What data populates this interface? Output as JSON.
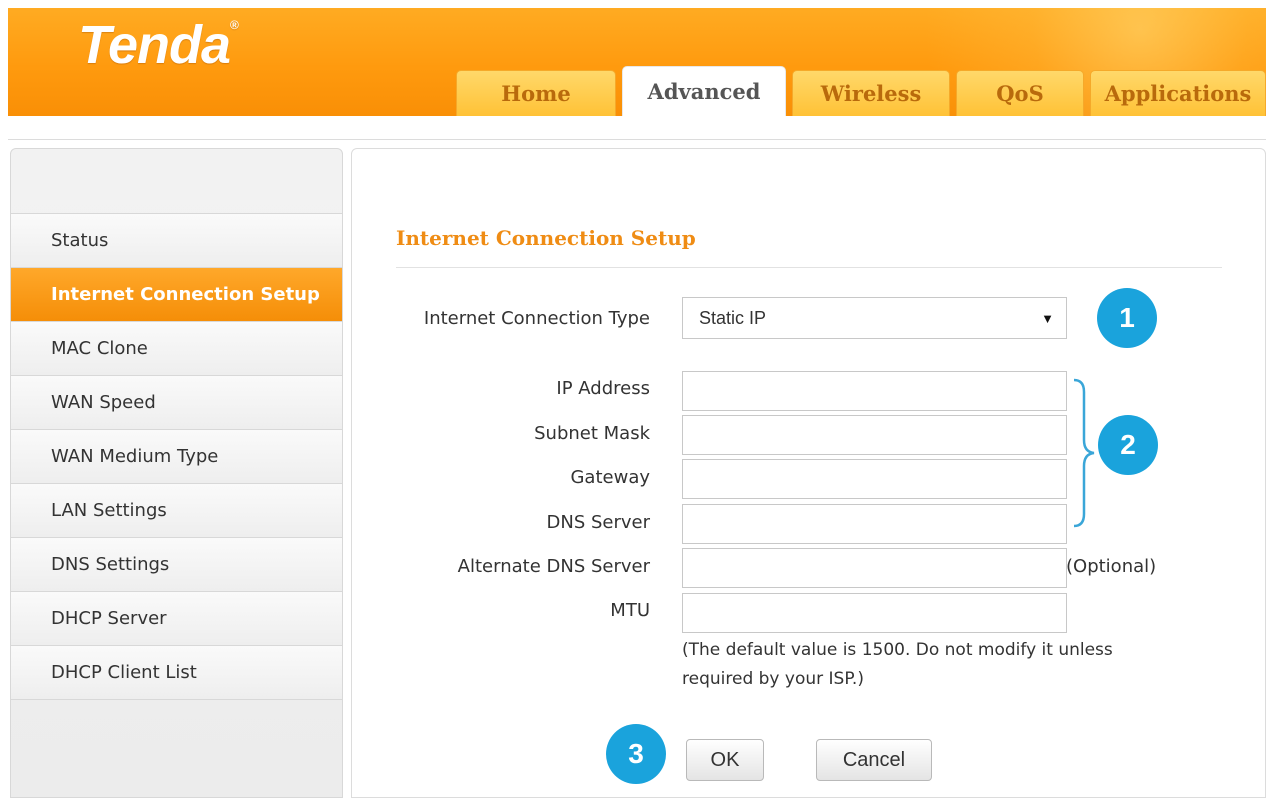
{
  "header": {
    "logo": "Tenda",
    "logo_mark": "®",
    "tabs": [
      {
        "label": "Home"
      },
      {
        "label": "Advanced"
      },
      {
        "label": "Wireless"
      },
      {
        "label": "QoS"
      },
      {
        "label": "Applications"
      }
    ],
    "active_tab": "Advanced"
  },
  "sidebar": {
    "items": [
      {
        "label": "Status"
      },
      {
        "label": "Internet Connection Setup"
      },
      {
        "label": "MAC Clone"
      },
      {
        "label": "WAN Speed"
      },
      {
        "label": "WAN Medium Type"
      },
      {
        "label": "LAN Settings"
      },
      {
        "label": "DNS Settings"
      },
      {
        "label": "DHCP Server"
      },
      {
        "label": "DHCP Client List"
      }
    ],
    "active_item": "Internet Connection Setup"
  },
  "form": {
    "title": "Internet Connection Setup",
    "connection_type_label": "Internet Connection Type",
    "connection_type_value": "Static IP",
    "ip_address_label": "IP Address",
    "ip_address_value": "",
    "subnet_mask_label": "Subnet Mask",
    "subnet_mask_value": "",
    "gateway_label": "Gateway",
    "gateway_value": "",
    "dns_server_label": "DNS Server",
    "dns_server_value": "",
    "alt_dns_label": "Alternate DNS Server",
    "alt_dns_value": "",
    "optional_note": "(Optional)",
    "mtu_label": "MTU",
    "mtu_value": "",
    "mtu_hint": "(The default value is 1500. Do not modify it unless required by your ISP.)",
    "ok_label": "OK",
    "cancel_label": "Cancel"
  },
  "annotations": {
    "badge_1": "1",
    "badge_2": "2",
    "badge_3": "3"
  },
  "colors": {
    "brand_orange": "#ff9a0e",
    "title_orange": "#ef8c14",
    "badge_blue": "#1aa3dc"
  }
}
